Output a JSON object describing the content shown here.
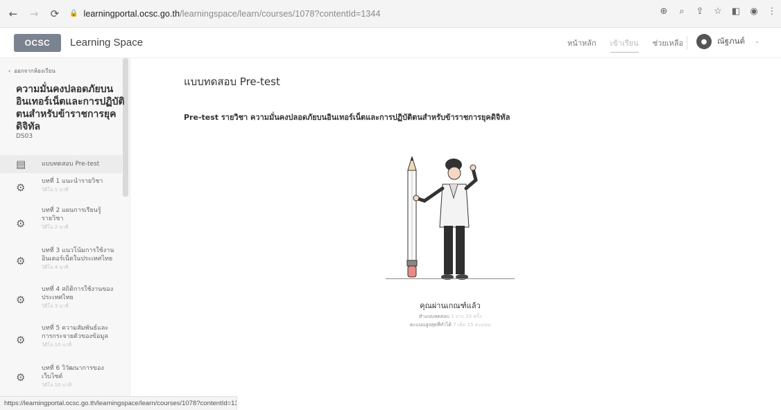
{
  "browser": {
    "url_domain": "learningportal.ocsc.go.th",
    "url_path": "/learningspace/learn/courses/1078?contentId=1344",
    "back_icon": "arrow-left-icon",
    "forward_icon": "arrow-right-icon",
    "reload_icon": "reload-icon",
    "lock_icon": "lock-icon"
  },
  "header": {
    "logo_text": "OCSC",
    "app_name": "Learning Space",
    "nav": [
      "หน้าหลัก",
      "เข้าเรียน",
      "ช่วยเหลือ"
    ],
    "active_nav_index": 1,
    "user_name": "ณัฐภนต์"
  },
  "sidebar": {
    "back_label": "ออกจากห้องเรียน",
    "course_title": "ความมั่นคงปลอดภัยบนอินเทอร์เน็ตและการปฏิบัติตนสำหรับข้าราชการยุคดิจิทัล",
    "course_code": "DS03",
    "lessons": [
      {
        "title": "แบบทดสอบ Pre-test",
        "sub": "",
        "icon": "quiz-icon",
        "active": true
      },
      {
        "title": "บทที่ 1 แนะนำรายวิชา",
        "sub": "วิดีโอ 1 นาที",
        "icon": "video-lesson-icon",
        "active": false
      },
      {
        "title": "บทที่ 2 แผนการเรียนรู้รายวิชา",
        "sub": "วิดีโอ 2 นาที",
        "icon": "video-lesson-icon",
        "active": false
      },
      {
        "title": "บทที่ 3 แนวโน้มการใช้งานอินเตอร์เน็ตในประเทศไทย",
        "sub": "วิดีโอ 4 นาที",
        "icon": "video-lesson-icon",
        "active": false
      },
      {
        "title": "บทที่ 4 สถิติการใช้งานของประเทศไทย",
        "sub": "วิดีโอ 3 นาที",
        "icon": "video-lesson-icon",
        "active": false
      },
      {
        "title": "บทที่ 5 ความสัมพันธ์และการกระจายตัวของข้อมูล",
        "sub": "วิดีโอ 10 นาที",
        "icon": "video-lesson-icon",
        "active": false
      },
      {
        "title": "บทที่ 6 วิวัฒนาการของเว็บไซต์",
        "sub": "วิดีโอ 10 นาที",
        "icon": "video-lesson-icon",
        "active": false
      }
    ]
  },
  "main": {
    "title": "แบบทดสอบ Pre-test",
    "subtitle": "Pre-test รายวิชา ความมั่นคงปลอดภัยบนอินเทอร์เน็ตและการปฏิบัติตนสำหรับข้าราชการยุคดิจิทัล",
    "result_title": "คุณผ่านเกณฑ์แล้ว",
    "attempts_label": "ทำแบบทดสอบ",
    "attempts_value": "1 จาก 10 ครั้ง",
    "best_score_label": "คะแนนสูงสุดที่ทำได้",
    "best_score_value": "7 เต็ม 15 คะแนน"
  },
  "statusbar": {
    "text": "https://learningportal.ocsc.go.th/learningspace/learn/courses/1078?contentId=13..."
  },
  "colors": {
    "logo_bg": "#7b8290",
    "sidebar_bg": "#f7f7f7",
    "active_lesson_bg": "#ececec"
  }
}
